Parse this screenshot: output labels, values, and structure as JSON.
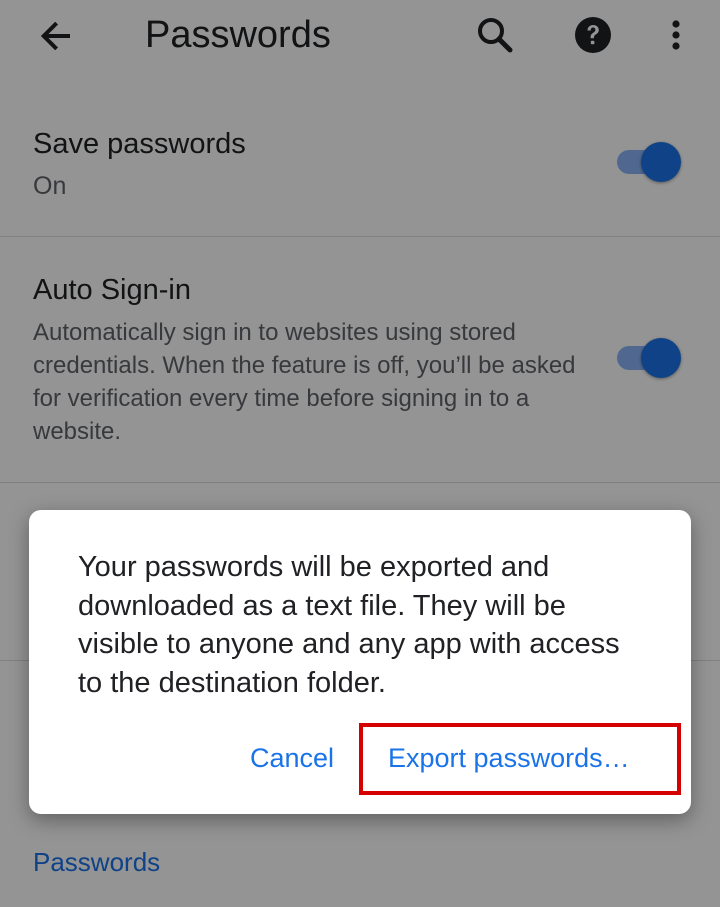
{
  "appbar": {
    "title": "Passwords",
    "icons": {
      "back": "arrow-back-icon",
      "search": "search-icon",
      "help": "help-icon",
      "more": "more-vert-icon"
    }
  },
  "settings": {
    "save_passwords": {
      "title": "Save passwords",
      "subtitle": "On",
      "enabled": true
    },
    "auto_signin": {
      "title": "Auto Sign-in",
      "subtitle": "Automatically sign in to websites using stored credentials. When the feature is off, you’ll be asked for verification every time before signing in to a website.",
      "enabled": true
    },
    "section_header": "Passwords"
  },
  "dialog": {
    "message": "Your passwords will be exported and downloaded as a text file. They will be visible to anyone and any app with access to the destination folder.",
    "cancel_label": "Cancel",
    "export_label": "Export passwords…"
  },
  "colors": {
    "accent": "#1a73e8",
    "switch_track": "#8ab4f8",
    "highlight_box": "#d50000"
  }
}
